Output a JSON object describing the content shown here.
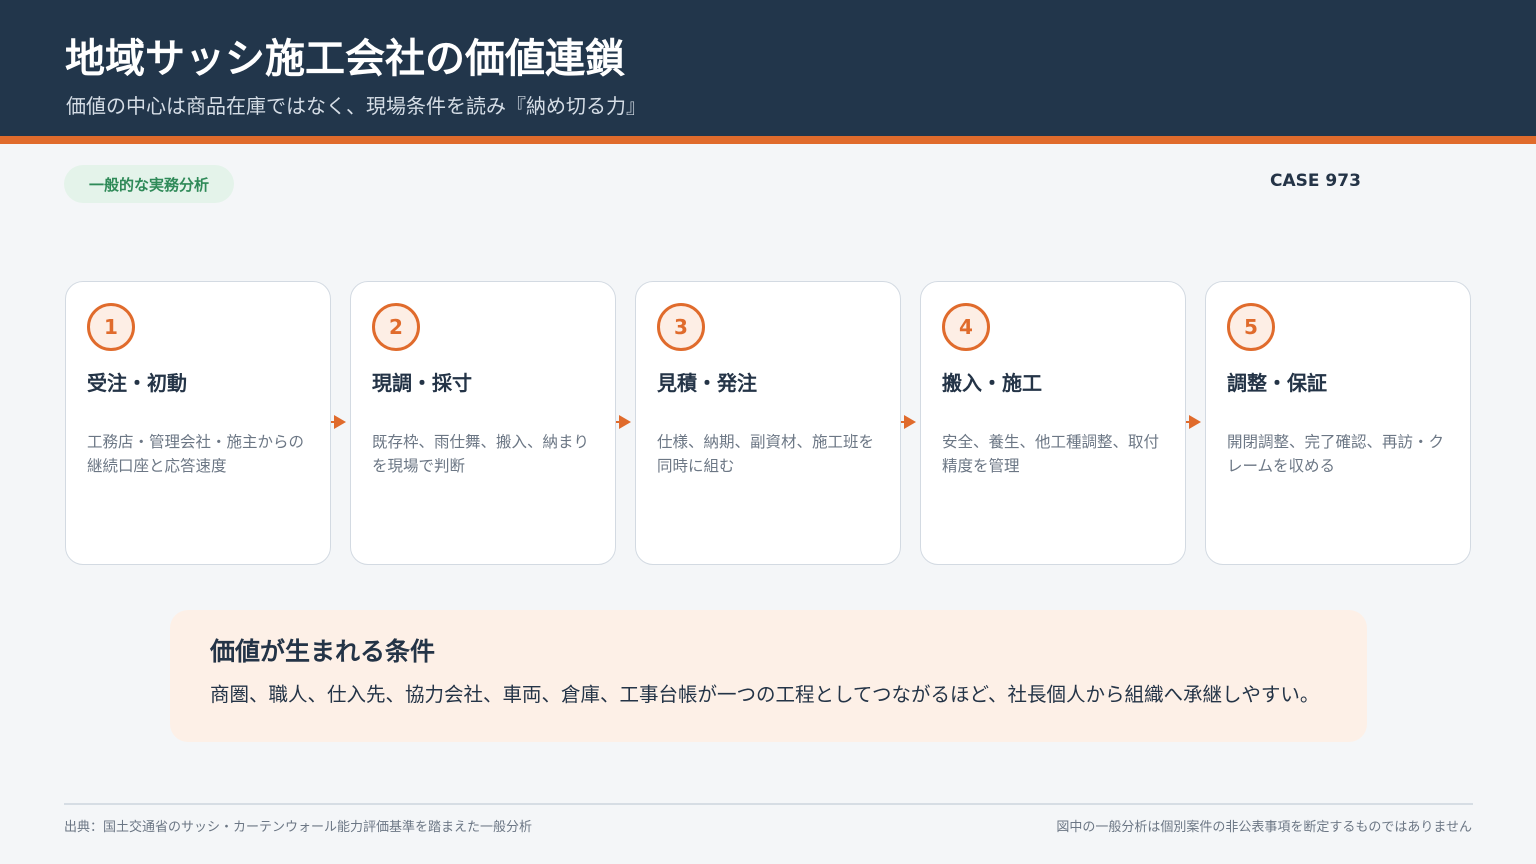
{
  "header": {
    "title": "地域サッシ施工会社の価値連鎖",
    "subtitle": "価値の中心は商品在庫ではなく、現場条件を読み『納め切る力』"
  },
  "tag": "一般的な実務分析",
  "case_label": "CASE 973",
  "steps": [
    {
      "number": "1",
      "title": "受注・初動",
      "description": "工務店・管理会社・施主からの継続口座と応答速度"
    },
    {
      "number": "2",
      "title": "現調・採寸",
      "description": "既存枠、雨仕舞、搬入、納まりを現場で判断"
    },
    {
      "number": "3",
      "title": "見積・発注",
      "description": "仕様、納期、副資材、施工班を同時に組む"
    },
    {
      "number": "4",
      "title": "搬入・施工",
      "description": "安全、養生、他工種調整、取付精度を管理"
    },
    {
      "number": "5",
      "title": "調整・保証",
      "description": "開閉調整、完了確認、再訪・クレームを収める"
    }
  ],
  "value_box": {
    "title": "価値が生まれる条件",
    "text": "商圏、職人、仕入先、協力会社、車両、倉庫、工事台帳が一つの工程としてつながるほど、社長個人から組織へ承継しやすい。"
  },
  "colors": {
    "header_bg": "#22364b",
    "accent": "#e06b2c",
    "tag_bg": "#e4f3ea",
    "tag_text": "#2f8a58",
    "value_bg": "#fdf0e7"
  },
  "footer": {
    "source": "出典：国土交通省のサッシ・カーテンウォール能力評価基準を踏まえた一般分析",
    "disclaimer": "図中の一般分析は個別案件の非公表事項を断定するものではありません"
  }
}
